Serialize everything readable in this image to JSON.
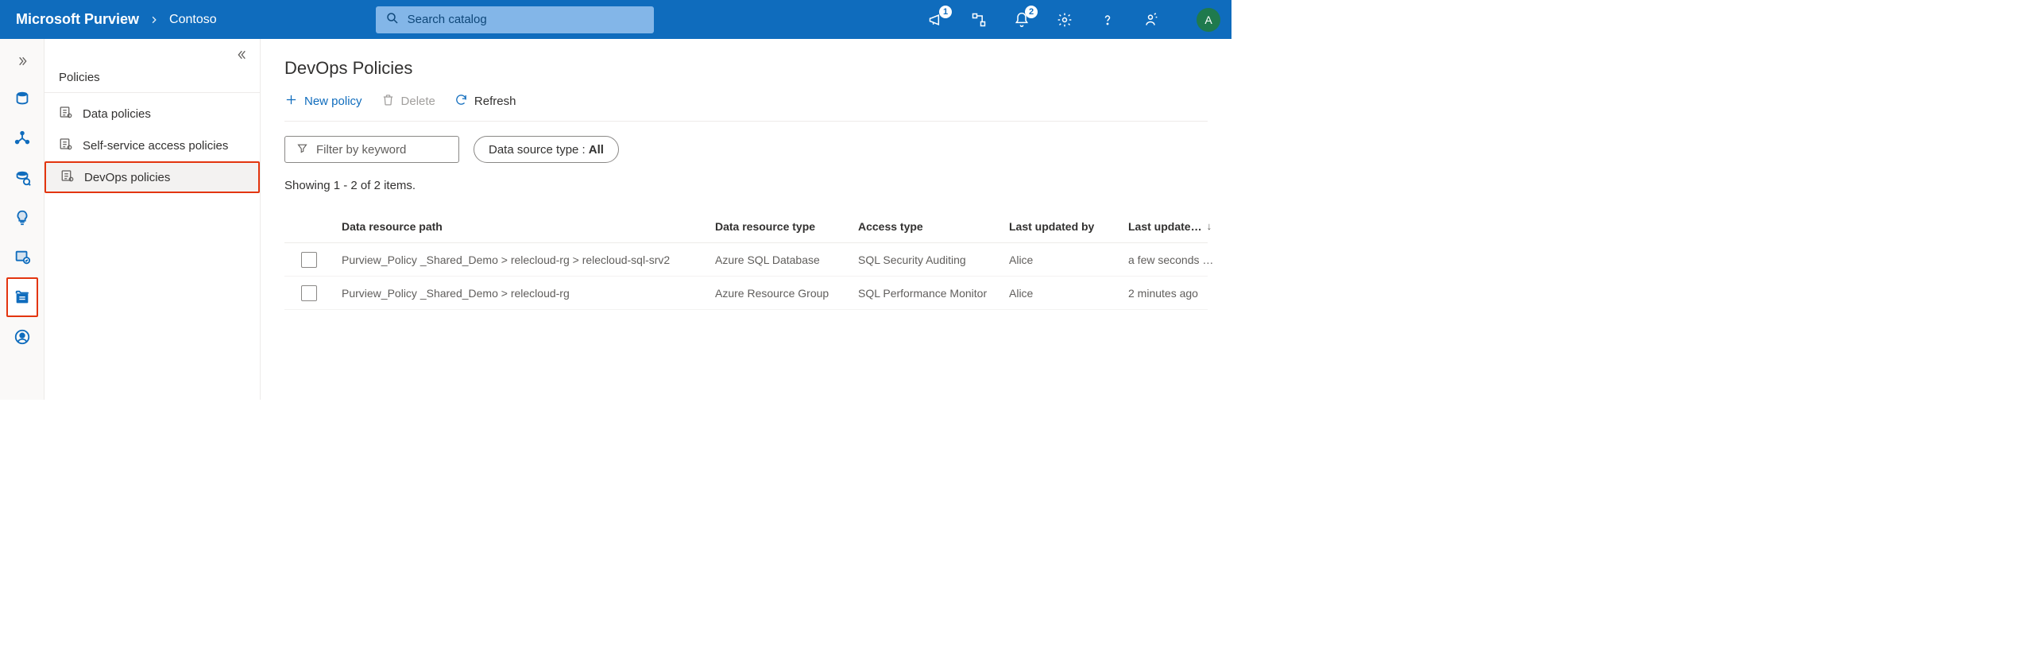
{
  "header": {
    "brand": "Microsoft Purview",
    "catalog": "Contoso",
    "search_placeholder": "Search catalog",
    "notif1_badge": "1",
    "notif2_badge": "2",
    "avatar_initial": "A"
  },
  "sidebar": {
    "title": "Policies",
    "items": [
      {
        "label": "Data policies"
      },
      {
        "label": "Self-service access policies"
      },
      {
        "label": "DevOps policies"
      }
    ]
  },
  "page": {
    "title": "DevOps Policies",
    "cmd_new": "New policy",
    "cmd_delete": "Delete",
    "cmd_refresh": "Refresh",
    "filter_placeholder": "Filter by keyword",
    "filter_type_label": "Data source type :",
    "filter_type_value": "All",
    "count_text": "Showing 1 - 2 of 2 items."
  },
  "table": {
    "cols": {
      "path": "Data resource path",
      "type": "Data resource type",
      "access": "Access type",
      "updated_by": "Last updated by",
      "updated_on": "Last update…"
    },
    "rows": [
      {
        "path": "Purview_Policy _Shared_Demo > relecloud-rg > relecloud-sql-srv2",
        "type": "Azure SQL Database",
        "access": "SQL Security Auditing",
        "updated_by": "Alice",
        "updated_on": "a few seconds …"
      },
      {
        "path": "Purview_Policy _Shared_Demo > relecloud-rg",
        "type": "Azure Resource Group",
        "access": "SQL Performance Monitor",
        "updated_by": "Alice",
        "updated_on": "2 minutes ago"
      }
    ]
  }
}
